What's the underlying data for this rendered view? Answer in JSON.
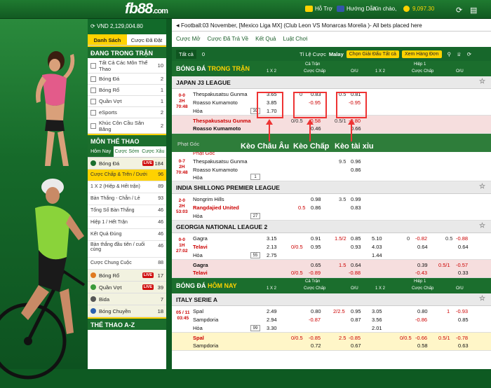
{
  "header": {
    "logo_main": "fb88",
    "logo_tld": ".com",
    "support": "Hỗ Trợ",
    "guide": "Hướng Dẫn",
    "greeting": "Xin chào,",
    "balance": "9,097.30"
  },
  "sidebar": {
    "currency": "VND 2,129,004.80",
    "tab_list": "Danh Sách",
    "tab_placed": "Cược Đã Đặt",
    "live_title": "ĐANG TRONG TRẬN",
    "live_items": [
      {
        "label": "Tất Cả Các Môn Thể Thao",
        "count": "10"
      },
      {
        "label": "Bóng Đá",
        "count": "2"
      },
      {
        "label": "Bóng Rổ",
        "count": "1"
      },
      {
        "label": "Quần Vợt",
        "count": "1"
      },
      {
        "label": "eSports",
        "count": "2"
      },
      {
        "label": "Khúc Côn Cầu Sân Băng",
        "count": "2"
      }
    ],
    "sports_title": "MÔN THỂ THAO",
    "sports_tabs": [
      "Hôm Nay",
      "Cược Sớm",
      "Cược Xâu"
    ],
    "football": {
      "label": "Bóng Đá",
      "live": "LIVE",
      "count": "184"
    },
    "football_subs": [
      {
        "label": "Cược Chấp & Trên / Dưới",
        "count": "96"
      },
      {
        "label": "1 X 2 (Hiệp & Hết trận)",
        "count": "89"
      },
      {
        "label": "Bàn Thắng - Chẵn / Lẻ",
        "count": "93"
      },
      {
        "label": "Tổng Số Bàn Thắng",
        "count": "46"
      },
      {
        "label": "Hiệp 1 / Hết Trận",
        "count": "46"
      },
      {
        "label": "Kết Quả Đúng",
        "count": "46"
      },
      {
        "label": "Bàn thắng đầu tiên / cuối cùng",
        "count": "46"
      },
      {
        "label": "Cược Chung Cuộc",
        "count": "88"
      }
    ],
    "other_sports": [
      {
        "label": "Bóng Rổ",
        "live": "LIVE",
        "count": "17"
      },
      {
        "label": "Quần Vợt",
        "live": "LIVE",
        "count": "39"
      },
      {
        "label": "Bida",
        "live": "",
        "count": "7"
      },
      {
        "label": "Bóng Chuyền",
        "live": "",
        "count": "18"
      }
    ],
    "az_title": "THỂ THAO A-Z"
  },
  "main": {
    "ticker": "Football:03 November, [Mexico Liga MX] (Club Leon VS Monarcas Morelia )- All bets placed here",
    "tabs": [
      "Cược Mở",
      "Cược Đã Trả Về",
      "Kết Quả",
      "Luật Chơi"
    ],
    "toolbar": {
      "all": "Tất cả",
      "count": "0",
      "odds_label": "Tỉ Lệ Cược",
      "odds_value": "Malay",
      "pick_league": "Chọn Giải Đấu",
      "pick_all": "Tất cả",
      "sort": "Xem Hàng Đơn"
    },
    "live_section": {
      "prefix": "BÓNG ĐÁ",
      "suffix": "TRONG TRẬN"
    },
    "today_section": {
      "prefix": "BÓNG ĐÁ",
      "suffix": "HÔM NAY"
    },
    "col": {
      "x12": "1 X 2",
      "full": "Cả Trận",
      "hc": "Cược Chấp",
      "ou": "O/U",
      "half": "Hiệp 1"
    },
    "leagues": {
      "japan": "JAPAN J3 LEAGUE",
      "india": "INDIA SHILLONG PREMIER LEAGUE",
      "georgia": "GEORGIA NATIONAL LEAGUE 2",
      "italy": "ITALY SERIE A"
    },
    "corner": "Phạt Góc",
    "annotations": {
      "a1": "Kèo Châu Âu",
      "a2": "Kèo Chấp",
      "a3": "Kèo tài xỉu"
    },
    "m1": {
      "score": "0-0",
      "half": "2H",
      "time": "70:48",
      "home": "Thespakusatsu Gunma",
      "away": "Roasso Kumamoto",
      "draw": "Hòa",
      "x_home": "3.65",
      "x_away": "3.85",
      "x_draw": "1.70",
      "hc_line": "0",
      "hc_home": "0.83",
      "hc_away": "-0.95",
      "ou_line": "0.5",
      "ou_over": "0.81",
      "ou_under": "-0.95",
      "more": "39"
    },
    "m1b": {
      "home": "Thespakusatsu Gunma",
      "away": "Roasso Kumamoto",
      "hc_line": "0/0.5",
      "hc_home": "-0.58",
      "hc_away": "0.46",
      "ou_line": "0.5/1",
      "ou_over": "-0.80",
      "ou_under": "0.66"
    },
    "m2": {
      "score": "0-7",
      "half": "2H",
      "time": "70:48",
      "label": "Phạt Góc",
      "home": "Thespakusatsu Gunma",
      "away": "Roasso Kumamoto",
      "draw": "Hòa",
      "ou_line": "9.5",
      "ou_over": "0.96",
      "ou_under": "0.86",
      "more": "1"
    },
    "m3": {
      "score": "2-0",
      "half": "2H",
      "time": "53:03",
      "home": "Nongrim Hills",
      "away": "Rangdajied United",
      "draw": "Hòa",
      "hc_home": "0.98",
      "hc_line": "0.5",
      "hc_away": "0.86",
      "ou_line": "3.5",
      "ou_over": "0.99",
      "ou_under": "0.83",
      "more": "27"
    },
    "m4": {
      "score": "0-0",
      "half": "1H",
      "time": "27:02",
      "home": "Gagra",
      "away": "Telavi",
      "draw": "Hòa",
      "x_home": "3.15",
      "x_away": "2.13",
      "x_draw": "2.75",
      "hc_home": "0.91",
      "hc_line": "0/0.5",
      "hc_away": "0.95",
      "ou_line": "1.5/2",
      "ou_over": "0.85",
      "ou_under": "0.93",
      "h_x_home": "5.10",
      "h_x_away": "4.03",
      "h_x_draw": "1.44",
      "h_hc_line": "0",
      "h_hc_home": "-0.82",
      "h_hc_away": "0.64",
      "h_ou_line": "0.5",
      "h_ou_over": "-0.88",
      "h_ou_under": "0.64",
      "more": "55"
    },
    "m4b": {
      "home": "Gagra",
      "away": "Telavi",
      "hc_home": "0.65",
      "hc_away": "-0.89",
      "hc_line": "0/0.5",
      "ou_line": "1.5",
      "ou_over": "0.64",
      "ou_under": "-0.88",
      "h_hc_home": "0.39",
      "h_hc_away": "-0.43",
      "h_ou_line": "0.5/1",
      "h_ou_over": "-0.57",
      "h_ou_under": "0.33"
    },
    "m5": {
      "date": "05 / 11",
      "time": "03:45",
      "home": "Spal",
      "away": "Sampdoria",
      "draw": "Hòa",
      "x_home": "2.49",
      "x_away": "2.94",
      "x_draw": "3.30",
      "hc_home": "0.80",
      "hc_line": "2/2.5",
      "hc_away": "-0.87",
      "ou_over": "0.95",
      "ou_under": "0.87",
      "h_x_home": "3.05",
      "h_x_away": "3.56",
      "h_x_draw": "2.01",
      "h_hc_home": "0.80",
      "h_hc_away": "-0.86",
      "h_ou_line": "1",
      "h_ou_over": "-0.93",
      "h_ou_under": "0.85",
      "more": "99"
    },
    "m5b": {
      "home": "Spal",
      "away": "Sampdoria",
      "hc_line": "0/0.5",
      "hc_home": "-0.85",
      "hc_away": "0.72",
      "ou_line": "2.5",
      "ou_over": "-0.85",
      "ou_under": "0.67",
      "h_hc_line": "0/0.5",
      "h_hc_home": "-0.66",
      "h_hc_away": "0.58",
      "h_ou_line": "0.5/1",
      "h_ou_over": "-0.78",
      "h_ou_under": "0.63"
    }
  }
}
